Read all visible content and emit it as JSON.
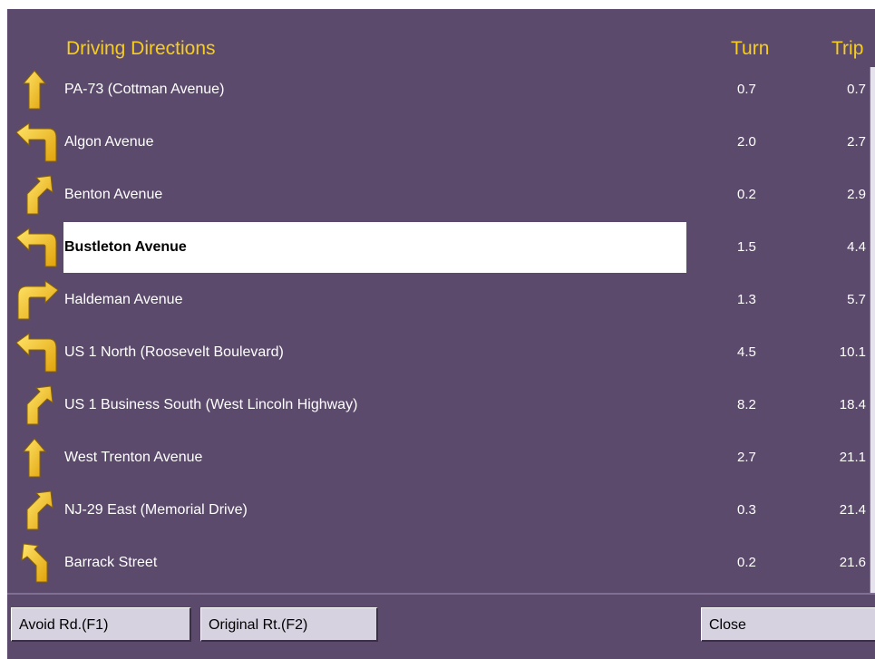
{
  "header": {
    "title": "Driving Directions",
    "turn_label": "Turn",
    "trip_label": "Trip"
  },
  "colors": {
    "background": "#5b4a6c",
    "accent": "#f7cd1e",
    "highlight": "#ffffff",
    "button": "#d6d2df"
  },
  "directions": [
    {
      "icon": "arrow-straight-icon",
      "name": "PA-73 (Cottman Avenue)",
      "turn": "0.7",
      "trip": "0.7"
    },
    {
      "icon": "arrow-left-turn-icon",
      "name": "Algon Avenue",
      "turn": "2.0",
      "trip": "2.7"
    },
    {
      "icon": "arrow-bear-right-icon",
      "name": "Benton Avenue",
      "turn": "0.2",
      "trip": "2.9"
    },
    {
      "icon": "arrow-left-turn-icon",
      "name": "Bustleton Avenue",
      "turn": "1.5",
      "trip": "4.4",
      "selected": true
    },
    {
      "icon": "arrow-right-turn-icon",
      "name": "Haldeman Avenue",
      "turn": "1.3",
      "trip": "5.7"
    },
    {
      "icon": "arrow-left-turn-icon",
      "name": "US 1 North (Roosevelt Boulevard)",
      "turn": "4.5",
      "trip": "10.1"
    },
    {
      "icon": "arrow-bear-right-icon",
      "name": "US 1 Business South (West Lincoln Highway)",
      "turn": "8.2",
      "trip": "18.4"
    },
    {
      "icon": "arrow-straight-icon",
      "name": "West Trenton Avenue",
      "turn": "2.7",
      "trip": "21.1"
    },
    {
      "icon": "arrow-bear-right-icon",
      "name": "NJ-29 East (Memorial Drive)",
      "turn": "0.3",
      "trip": "21.4"
    },
    {
      "icon": "arrow-bear-left-icon",
      "name": "Barrack Street",
      "turn": "0.2",
      "trip": "21.6"
    }
  ],
  "buttons": {
    "avoid": "Avoid Rd.(F1)",
    "original": "Original Rt.(F2)",
    "close": "Close"
  }
}
